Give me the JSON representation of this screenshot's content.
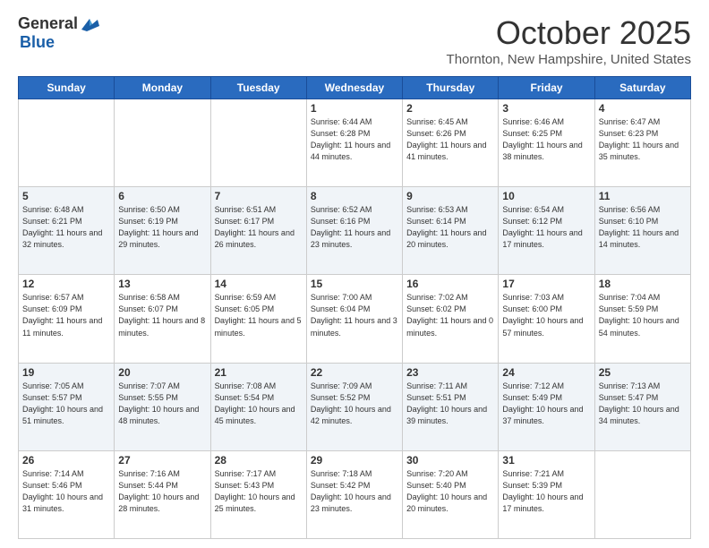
{
  "logo": {
    "part1": "General",
    "part2": "Blue"
  },
  "header": {
    "month": "October 2025",
    "location": "Thornton, New Hampshire, United States"
  },
  "weekdays": [
    "Sunday",
    "Monday",
    "Tuesday",
    "Wednesday",
    "Thursday",
    "Friday",
    "Saturday"
  ],
  "weeks": [
    [
      {
        "day": "",
        "sunrise": "",
        "sunset": "",
        "daylight": ""
      },
      {
        "day": "",
        "sunrise": "",
        "sunset": "",
        "daylight": ""
      },
      {
        "day": "",
        "sunrise": "",
        "sunset": "",
        "daylight": ""
      },
      {
        "day": "1",
        "sunrise": "Sunrise: 6:44 AM",
        "sunset": "Sunset: 6:28 PM",
        "daylight": "Daylight: 11 hours and 44 minutes."
      },
      {
        "day": "2",
        "sunrise": "Sunrise: 6:45 AM",
        "sunset": "Sunset: 6:26 PM",
        "daylight": "Daylight: 11 hours and 41 minutes."
      },
      {
        "day": "3",
        "sunrise": "Sunrise: 6:46 AM",
        "sunset": "Sunset: 6:25 PM",
        "daylight": "Daylight: 11 hours and 38 minutes."
      },
      {
        "day": "4",
        "sunrise": "Sunrise: 6:47 AM",
        "sunset": "Sunset: 6:23 PM",
        "daylight": "Daylight: 11 hours and 35 minutes."
      }
    ],
    [
      {
        "day": "5",
        "sunrise": "Sunrise: 6:48 AM",
        "sunset": "Sunset: 6:21 PM",
        "daylight": "Daylight: 11 hours and 32 minutes."
      },
      {
        "day": "6",
        "sunrise": "Sunrise: 6:50 AM",
        "sunset": "Sunset: 6:19 PM",
        "daylight": "Daylight: 11 hours and 29 minutes."
      },
      {
        "day": "7",
        "sunrise": "Sunrise: 6:51 AM",
        "sunset": "Sunset: 6:17 PM",
        "daylight": "Daylight: 11 hours and 26 minutes."
      },
      {
        "day": "8",
        "sunrise": "Sunrise: 6:52 AM",
        "sunset": "Sunset: 6:16 PM",
        "daylight": "Daylight: 11 hours and 23 minutes."
      },
      {
        "day": "9",
        "sunrise": "Sunrise: 6:53 AM",
        "sunset": "Sunset: 6:14 PM",
        "daylight": "Daylight: 11 hours and 20 minutes."
      },
      {
        "day": "10",
        "sunrise": "Sunrise: 6:54 AM",
        "sunset": "Sunset: 6:12 PM",
        "daylight": "Daylight: 11 hours and 17 minutes."
      },
      {
        "day": "11",
        "sunrise": "Sunrise: 6:56 AM",
        "sunset": "Sunset: 6:10 PM",
        "daylight": "Daylight: 11 hours and 14 minutes."
      }
    ],
    [
      {
        "day": "12",
        "sunrise": "Sunrise: 6:57 AM",
        "sunset": "Sunset: 6:09 PM",
        "daylight": "Daylight: 11 hours and 11 minutes."
      },
      {
        "day": "13",
        "sunrise": "Sunrise: 6:58 AM",
        "sunset": "Sunset: 6:07 PM",
        "daylight": "Daylight: 11 hours and 8 minutes."
      },
      {
        "day": "14",
        "sunrise": "Sunrise: 6:59 AM",
        "sunset": "Sunset: 6:05 PM",
        "daylight": "Daylight: 11 hours and 5 minutes."
      },
      {
        "day": "15",
        "sunrise": "Sunrise: 7:00 AM",
        "sunset": "Sunset: 6:04 PM",
        "daylight": "Daylight: 11 hours and 3 minutes."
      },
      {
        "day": "16",
        "sunrise": "Sunrise: 7:02 AM",
        "sunset": "Sunset: 6:02 PM",
        "daylight": "Daylight: 11 hours and 0 minutes."
      },
      {
        "day": "17",
        "sunrise": "Sunrise: 7:03 AM",
        "sunset": "Sunset: 6:00 PM",
        "daylight": "Daylight: 10 hours and 57 minutes."
      },
      {
        "day": "18",
        "sunrise": "Sunrise: 7:04 AM",
        "sunset": "Sunset: 5:59 PM",
        "daylight": "Daylight: 10 hours and 54 minutes."
      }
    ],
    [
      {
        "day": "19",
        "sunrise": "Sunrise: 7:05 AM",
        "sunset": "Sunset: 5:57 PM",
        "daylight": "Daylight: 10 hours and 51 minutes."
      },
      {
        "day": "20",
        "sunrise": "Sunrise: 7:07 AM",
        "sunset": "Sunset: 5:55 PM",
        "daylight": "Daylight: 10 hours and 48 minutes."
      },
      {
        "day": "21",
        "sunrise": "Sunrise: 7:08 AM",
        "sunset": "Sunset: 5:54 PM",
        "daylight": "Daylight: 10 hours and 45 minutes."
      },
      {
        "day": "22",
        "sunrise": "Sunrise: 7:09 AM",
        "sunset": "Sunset: 5:52 PM",
        "daylight": "Daylight: 10 hours and 42 minutes."
      },
      {
        "day": "23",
        "sunrise": "Sunrise: 7:11 AM",
        "sunset": "Sunset: 5:51 PM",
        "daylight": "Daylight: 10 hours and 39 minutes."
      },
      {
        "day": "24",
        "sunrise": "Sunrise: 7:12 AM",
        "sunset": "Sunset: 5:49 PM",
        "daylight": "Daylight: 10 hours and 37 minutes."
      },
      {
        "day": "25",
        "sunrise": "Sunrise: 7:13 AM",
        "sunset": "Sunset: 5:47 PM",
        "daylight": "Daylight: 10 hours and 34 minutes."
      }
    ],
    [
      {
        "day": "26",
        "sunrise": "Sunrise: 7:14 AM",
        "sunset": "Sunset: 5:46 PM",
        "daylight": "Daylight: 10 hours and 31 minutes."
      },
      {
        "day": "27",
        "sunrise": "Sunrise: 7:16 AM",
        "sunset": "Sunset: 5:44 PM",
        "daylight": "Daylight: 10 hours and 28 minutes."
      },
      {
        "day": "28",
        "sunrise": "Sunrise: 7:17 AM",
        "sunset": "Sunset: 5:43 PM",
        "daylight": "Daylight: 10 hours and 25 minutes."
      },
      {
        "day": "29",
        "sunrise": "Sunrise: 7:18 AM",
        "sunset": "Sunset: 5:42 PM",
        "daylight": "Daylight: 10 hours and 23 minutes."
      },
      {
        "day": "30",
        "sunrise": "Sunrise: 7:20 AM",
        "sunset": "Sunset: 5:40 PM",
        "daylight": "Daylight: 10 hours and 20 minutes."
      },
      {
        "day": "31",
        "sunrise": "Sunrise: 7:21 AM",
        "sunset": "Sunset: 5:39 PM",
        "daylight": "Daylight: 10 hours and 17 minutes."
      },
      {
        "day": "",
        "sunrise": "",
        "sunset": "",
        "daylight": ""
      }
    ]
  ]
}
